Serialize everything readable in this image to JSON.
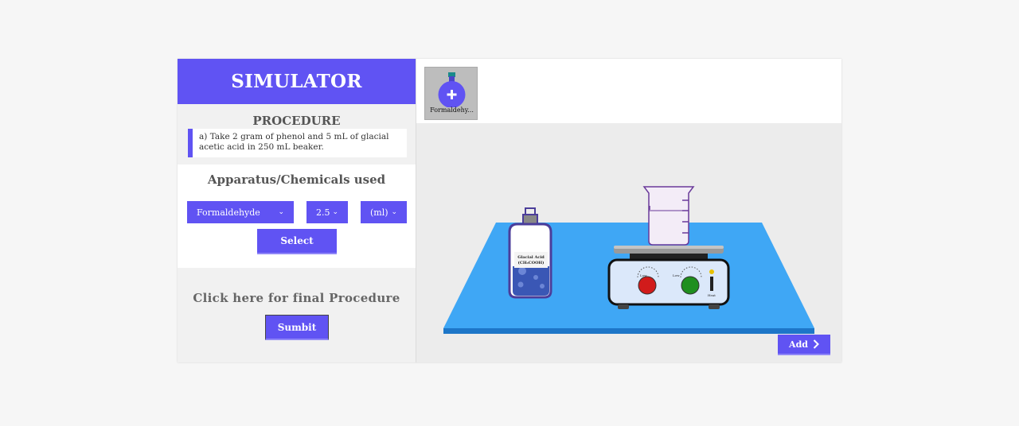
{
  "header": {
    "title": "SIMULATOR"
  },
  "procedure": {
    "title": "PROCEDURE",
    "step": "a) Take 2 gram of phenol and 5 mL of glacial acetic acid in 250 mL beaker."
  },
  "apparatus": {
    "title": "Apparatus/Chemicals used",
    "chemical": "Formaldehyde",
    "amount": "2.5",
    "unit": "(ml)",
    "select_label": "Select"
  },
  "final": {
    "title": "Click here for final Procedure",
    "submit_label": "Sumbit"
  },
  "tray": {
    "item_label": "Formaldehy..."
  },
  "bottle": {
    "label_line1": "Glacial Acid",
    "label_line2": "(CH₃COOH)"
  },
  "hotplate": {
    "knob1_label": "Low",
    "knob2_label": "Low",
    "indicator_label": "Heat"
  },
  "add_label": "Add",
  "colors": {
    "accent": "#6053f3",
    "table": "#3fa7f5",
    "knob_red": "#d11b1b",
    "knob_green": "#1f8f1f"
  }
}
